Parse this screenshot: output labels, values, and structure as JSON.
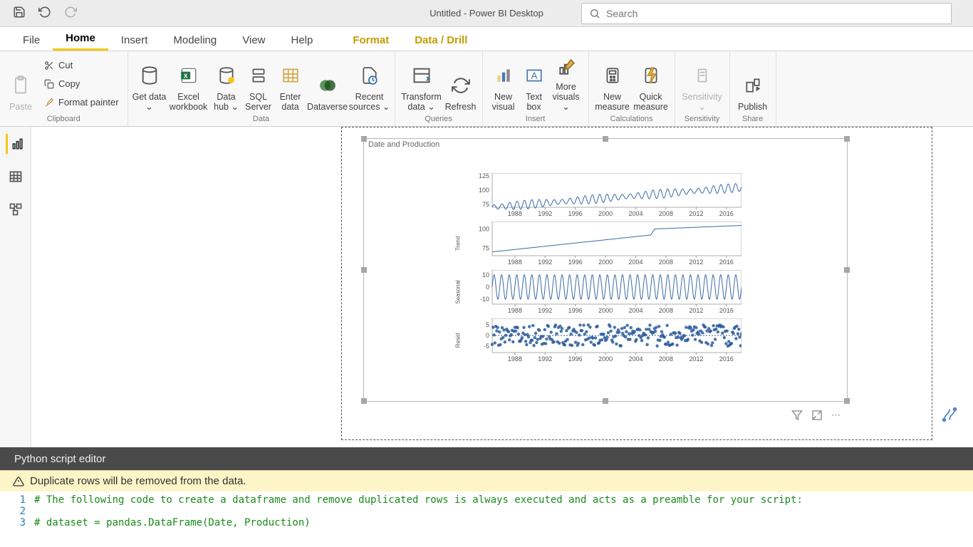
{
  "app": {
    "title": "Untitled - Power BI Desktop"
  },
  "search": {
    "placeholder": "Search"
  },
  "tabs": {
    "file": "File",
    "home": "Home",
    "insert": "Insert",
    "modeling": "Modeling",
    "view": "View",
    "help": "Help",
    "format": "Format",
    "data_drill": "Data / Drill"
  },
  "ribbon": {
    "clipboard": {
      "label": "Clipboard",
      "paste": "Paste",
      "cut": "Cut",
      "copy": "Copy",
      "format_painter": "Format painter"
    },
    "data": {
      "label": "Data",
      "get_data": "Get data",
      "excel": "Excel workbook",
      "data_hub": "Data hub",
      "sql": "SQL Server",
      "enter": "Enter data",
      "dataverse": "Dataverse",
      "recent": "Recent sources"
    },
    "queries": {
      "label": "Queries",
      "transform": "Transform data",
      "refresh": "Refresh"
    },
    "insert": {
      "label": "Insert",
      "new_visual": "New visual",
      "text_box": "Text box",
      "more": "More visuals"
    },
    "calc": {
      "label": "Calculations",
      "new_measure": "New measure",
      "quick": "Quick measure"
    },
    "sensitivity": {
      "label": "Sensitivity",
      "btn": "Sensitivity"
    },
    "share": {
      "label": "Share",
      "publish": "Publish"
    }
  },
  "visual": {
    "title": "Date and Production"
  },
  "chart_data": [
    {
      "type": "line",
      "panel_label": "",
      "x_ticks": [
        1988,
        1992,
        1996,
        2000,
        2004,
        2008,
        2012,
        2016
      ],
      "y_ticks": [
        75,
        100,
        125
      ],
      "ylim": [
        70,
        130
      ],
      "description": "Observed production time series with seasonal fluctuations rising from ~75 to ~110."
    },
    {
      "type": "line",
      "panel_label": "Trend",
      "x_ticks": [
        1988,
        1992,
        1996,
        2000,
        2004,
        2008,
        2012,
        2016
      ],
      "y_ticks": [
        75,
        100
      ],
      "ylim": [
        65,
        110
      ],
      "description": "Smooth trend increasing from ~70 plateauing near ~105."
    },
    {
      "type": "line",
      "panel_label": "Seasonal",
      "x_ticks": [
        1988,
        1992,
        1996,
        2000,
        2004,
        2008,
        2012,
        2016
      ],
      "y_ticks": [
        -10,
        0,
        10
      ],
      "ylim": [
        -14,
        14
      ],
      "description": "Repeating annual seasonal component roughly ±10."
    },
    {
      "type": "scatter",
      "panel_label": "Resid",
      "x_ticks": [
        1988,
        1992,
        1996,
        2000,
        2004,
        2008,
        2012,
        2016
      ],
      "y_ticks": [
        -5,
        0,
        5
      ],
      "ylim": [
        -8,
        8
      ],
      "description": "Residual noise scattered mostly within ±5."
    }
  ],
  "editor": {
    "title": "Python script editor",
    "warning": "Duplicate rows will be removed from the data.",
    "lines": [
      "# The following code to create a dataframe and remove duplicated rows is always executed and acts as a preamble for your script:",
      "",
      "# dataset = pandas.DataFrame(Date, Production)"
    ]
  }
}
